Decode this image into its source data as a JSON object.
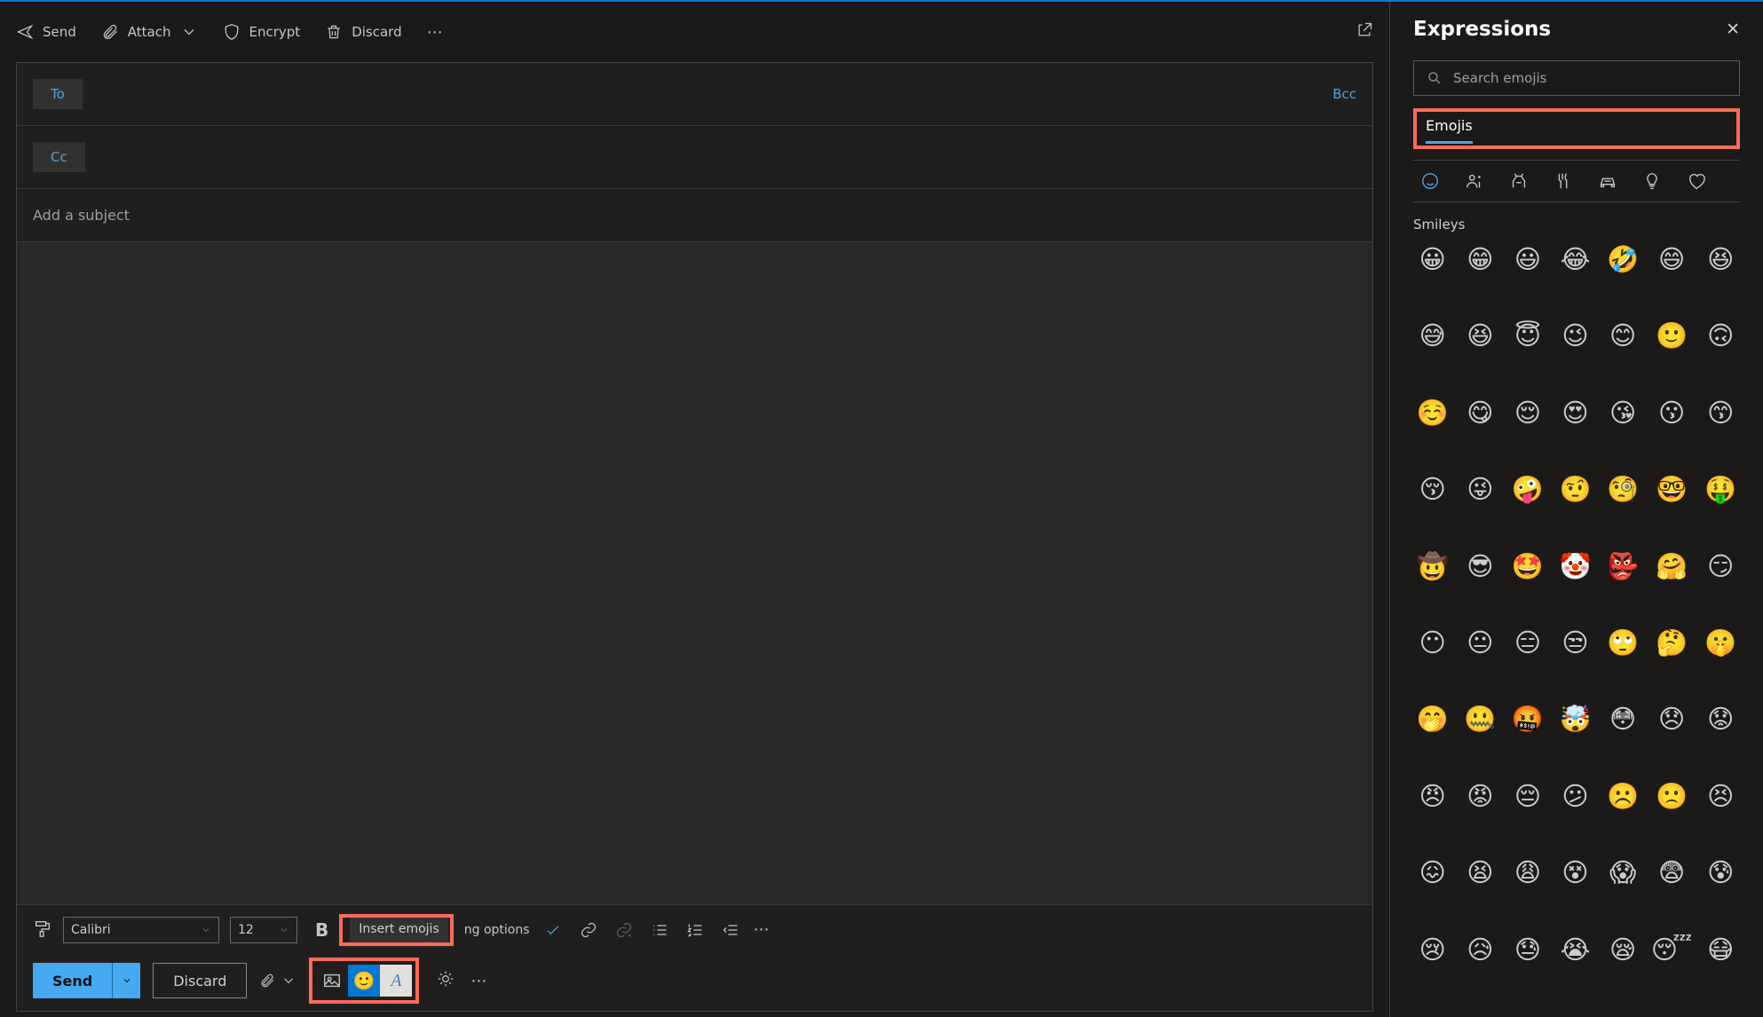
{
  "toolbar": {
    "send": "Send",
    "attach": "Attach",
    "encrypt": "Encrypt",
    "discard": "Discard"
  },
  "recipients": {
    "to": "To",
    "cc": "Cc",
    "bcc": "Bcc"
  },
  "subject": {
    "placeholder": "Add a subject"
  },
  "format": {
    "font": "Calibri",
    "size": "12",
    "tooltip": "Insert emojis",
    "options_suffix": "ng options"
  },
  "bottom": {
    "send": "Send",
    "discard": "Discard"
  },
  "expr": {
    "title": "Expressions",
    "search_placeholder": "Search emojis",
    "tab": "Emojis",
    "section": "Smileys",
    "emojis": [
      "😀",
      "😁",
      "😃",
      "😂",
      "🤣",
      "😄",
      "😆",
      "😅",
      "😆",
      "😇",
      "😉",
      "😊",
      "🙂",
      "🙃",
      "☺️",
      "😋",
      "😌",
      "😍",
      "😘",
      "😗",
      "😙",
      "😚",
      "😜",
      "🤪",
      "🤨",
      "🧐",
      "🤓",
      "🤑",
      "🤠",
      "😎",
      "🤩",
      "🤡",
      "👺",
      "🤗",
      "😏",
      "😶",
      "😐",
      "😑",
      "😒",
      "🙄",
      "🤔",
      "🤫",
      "🤭",
      "🤐",
      "🤬",
      "🤯",
      "😳",
      "😞",
      "😟",
      "😠",
      "😡",
      "😔",
      "😕",
      "☹️",
      "🙁",
      "😣",
      "😖",
      "😫",
      "😩",
      "😵",
      "😱",
      "😨",
      "😰",
      "😢",
      "😥",
      "😓",
      "😭",
      "😪",
      "😴",
      "😷"
    ]
  }
}
